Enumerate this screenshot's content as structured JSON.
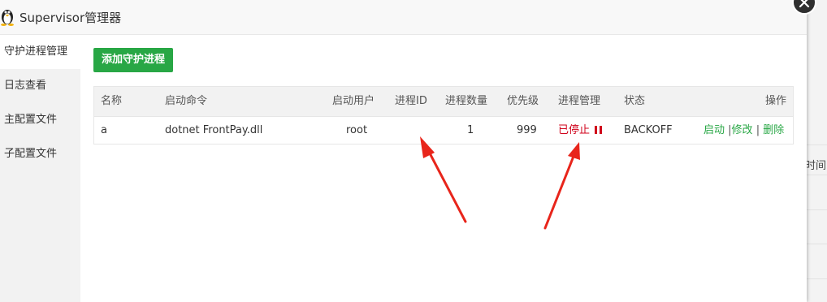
{
  "window": {
    "title": "Supervisor管理器"
  },
  "sidebar": {
    "items": [
      {
        "label": "守护进程管理",
        "active": true
      },
      {
        "label": "日志查看",
        "active": false
      },
      {
        "label": "主配置文件",
        "active": false
      },
      {
        "label": "子配置文件",
        "active": false
      }
    ]
  },
  "toolbar": {
    "add_label": "添加守护进程"
  },
  "table": {
    "headers": {
      "name": "名称",
      "command": "启动命令",
      "user": "启动用户",
      "pid": "进程ID",
      "count": "进程数量",
      "priority": "优先级",
      "manage": "进程管理",
      "status": "状态",
      "actions": "操作"
    },
    "rows": [
      {
        "name": "a",
        "command": "dotnet FrontPay.dll",
        "user": "root",
        "pid": "",
        "count": "1",
        "priority": "999",
        "manage": "已停止",
        "status": "BACKOFF",
        "start": "启动",
        "edit": "修改",
        "delete": "删除"
      }
    ]
  },
  "background": {
    "partial_text": "时间"
  },
  "icons": {
    "logo": "tux-icon",
    "close": "close-icon",
    "pause": "pause-icon"
  },
  "colors": {
    "accent": "#28a745",
    "danger": "#d0021b",
    "annotation": "#e8251b"
  }
}
